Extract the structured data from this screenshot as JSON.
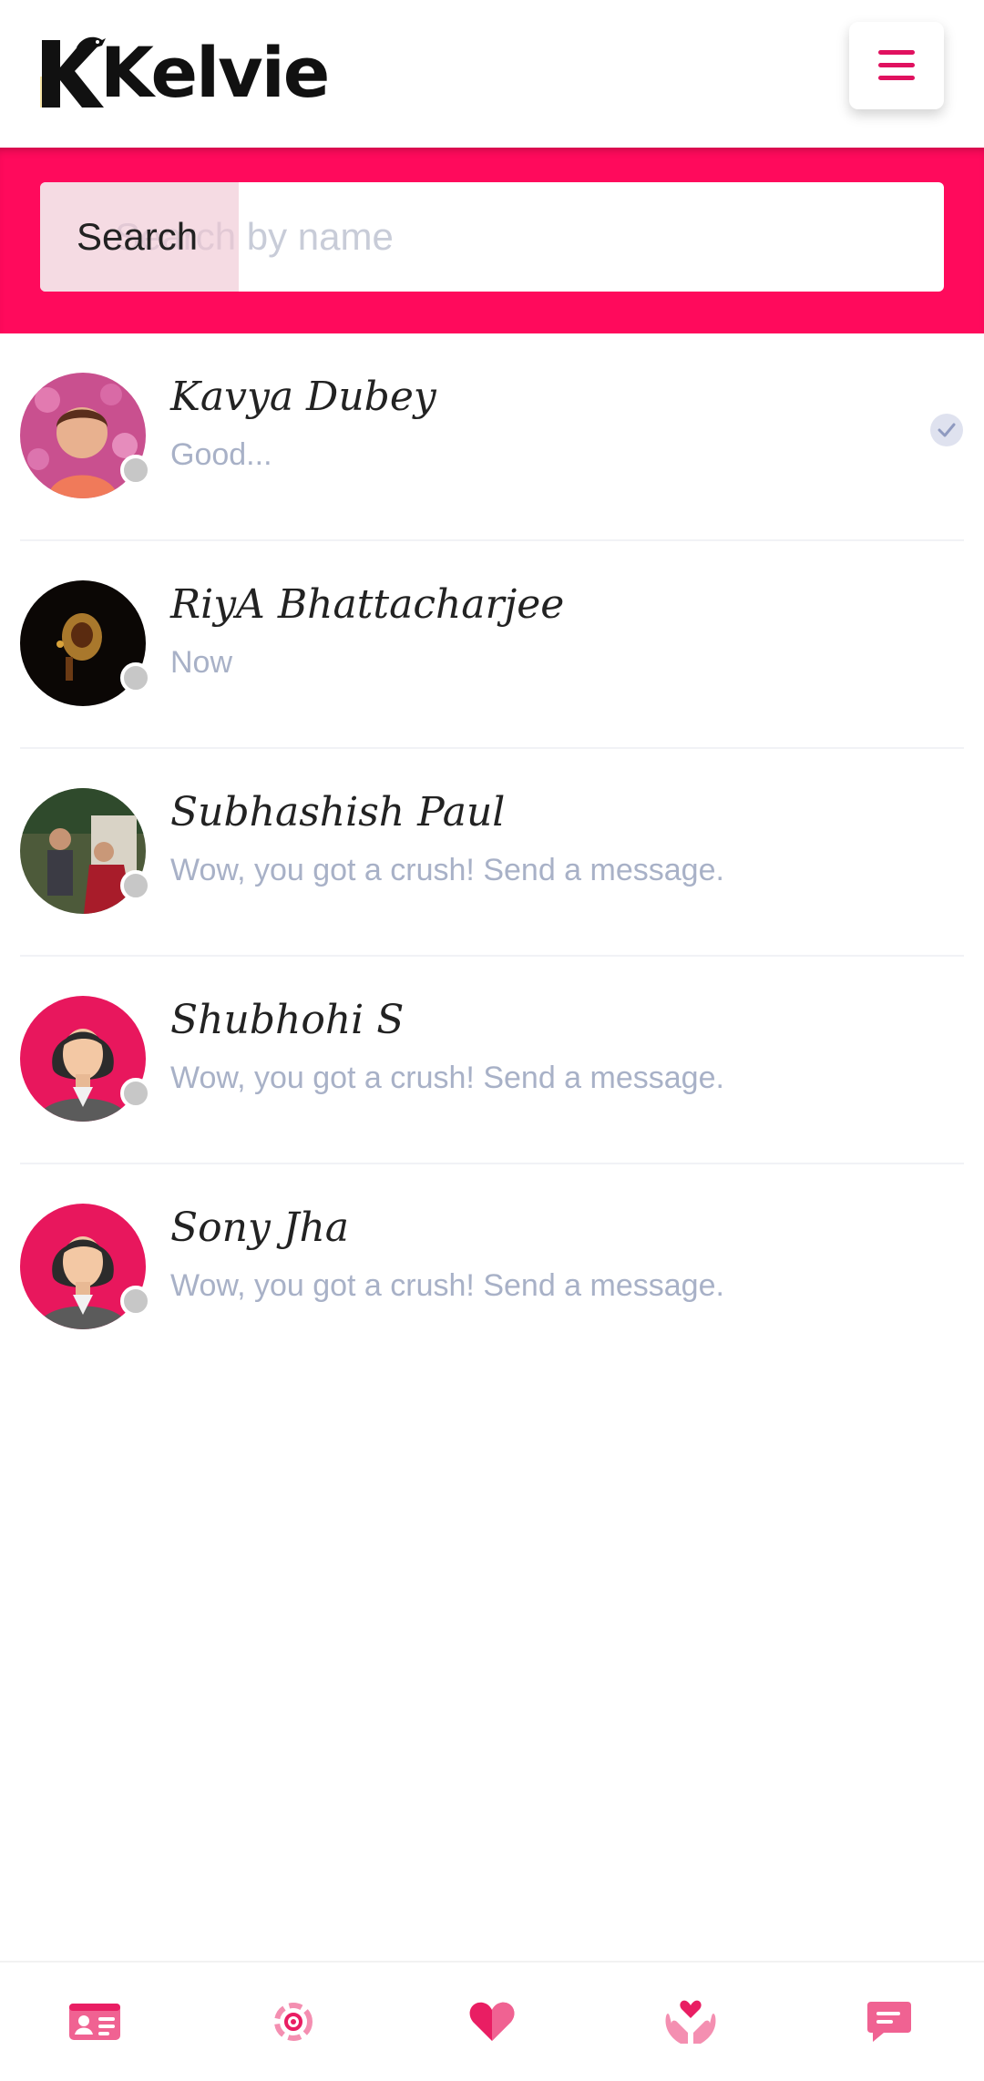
{
  "app": {
    "brand": "Kelvie",
    "colors": {
      "accent": "#ff0a5c",
      "muted": "#a8b1c7"
    }
  },
  "header": {
    "menu_icon": "hamburger-menu-icon"
  },
  "search": {
    "label": "Search",
    "placeholder": "Search by name"
  },
  "chats": [
    {
      "name": "Kavya Dubey",
      "preview": "Good...",
      "read": true,
      "avatar": "photo"
    },
    {
      "name": "RiyA Bhattacharjee",
      "preview": "Now",
      "read": false,
      "avatar": "photo"
    },
    {
      "name": "Subhashish Paul",
      "preview": "Wow, you got a crush! Send a message.",
      "read": false,
      "avatar": "photo"
    },
    {
      "name": "Shubhohi S",
      "preview": "Wow, you got a crush! Send a message.",
      "read": false,
      "avatar": "default-female"
    },
    {
      "name": "Sony Jha",
      "preview": "Wow, you got a crush! Send a message.",
      "read": false,
      "avatar": "default-female"
    }
  ],
  "bottom_nav": [
    {
      "icon": "profile-card-icon"
    },
    {
      "icon": "discover-icon"
    },
    {
      "icon": "heart-icon"
    },
    {
      "icon": "hands-heart-icon"
    },
    {
      "icon": "chat-icon"
    }
  ]
}
